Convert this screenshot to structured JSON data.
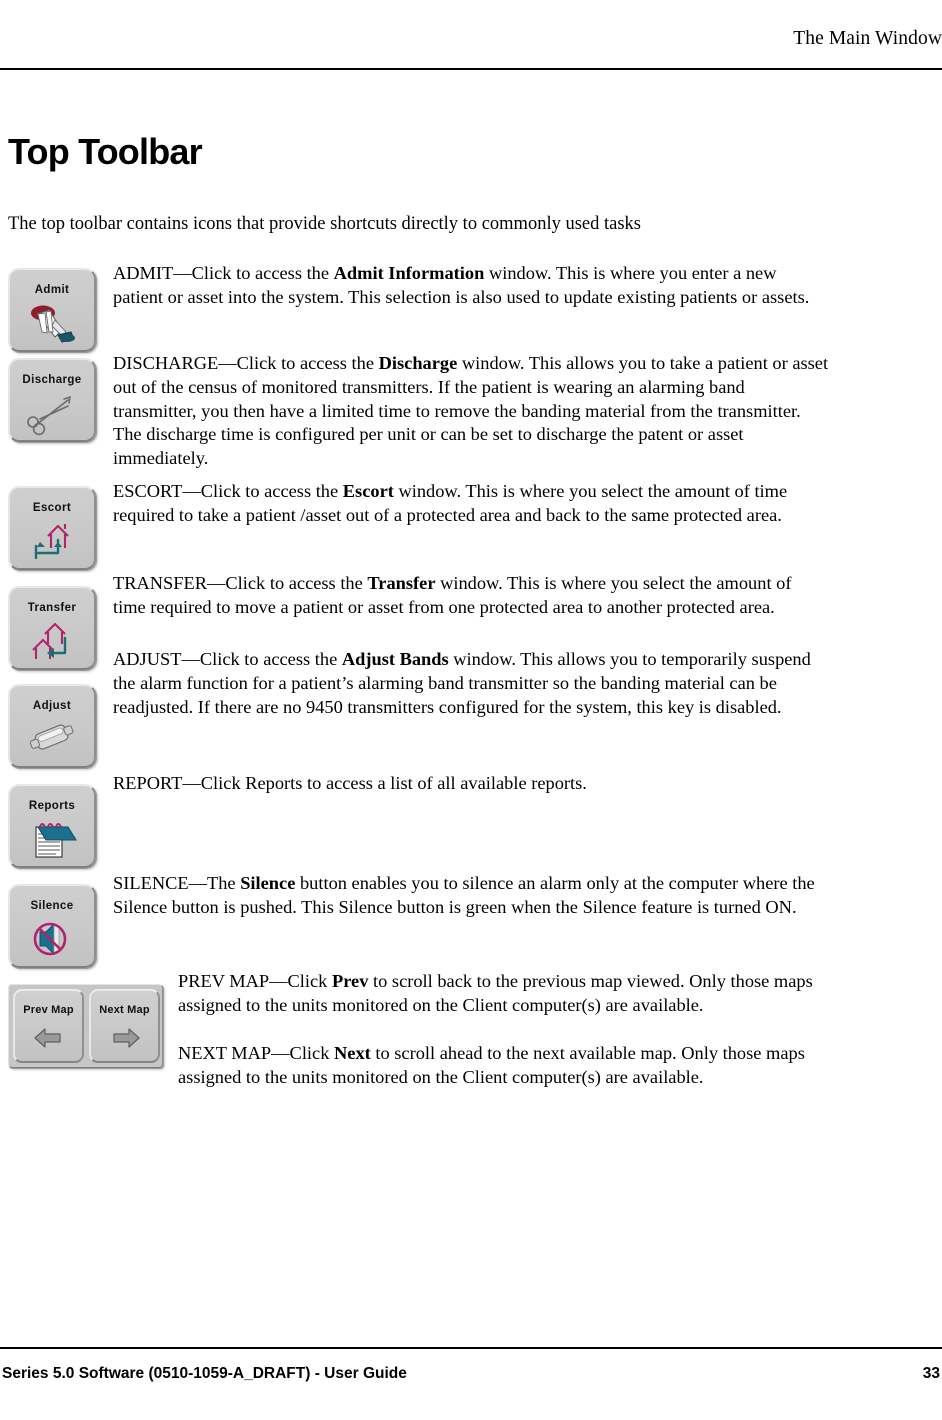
{
  "header": {
    "running_head": "The Main Window"
  },
  "heading": "Top Toolbar",
  "intro": "The top toolbar contains icons that provide shortcuts directly to commonly used tasks",
  "buttons": {
    "admit": {
      "label": "Admit",
      "icon": "hand-pointing-icon"
    },
    "discharge": {
      "label": "Discharge",
      "icon": "scissors-icon"
    },
    "escort": {
      "label": "Escort",
      "icon": "house-round-trip-arrow-icon"
    },
    "transfer": {
      "label": "Transfer",
      "icon": "two-houses-arrow-icon"
    },
    "adjust": {
      "label": "Adjust",
      "icon": "band-transmitter-icon"
    },
    "reports": {
      "label": "Reports",
      "icon": "notepad-icon"
    },
    "silence": {
      "label": "Silence",
      "icon": "speaker-muted-icon"
    },
    "prev_map": {
      "label": "Prev Map",
      "icon": "arrow-left-icon"
    },
    "next_map": {
      "label": "Next Map",
      "icon": "arrow-right-icon"
    }
  },
  "entries": [
    {
      "key": "admit",
      "lead": "ADMIT",
      "text_1": "ADMIT—Click to access the ",
      "bold_1": "Admit Information",
      "text_2": " window. This is where you enter a new patient or asset into the system. This selection is also used to update existing patients or assets."
    },
    {
      "key": "discharge",
      "lead": "DISCHARGE",
      "text_1": " DISCHARGE—Click to access the ",
      "bold_1": "Discharge",
      "text_2": " window. This allows you to take a patient or asset out of the census of monitored transmitters. If the patient is wearing an alarming band transmitter, you then have a limited time to remove the banding material from the transmitter. The discharge time is configured per unit or can be set to discharge the patent or asset immediately."
    },
    {
      "key": "escort",
      "lead": "ESCORT",
      "text_1": "ESCORT—Click to access the ",
      "bold_1": "Escort",
      "text_2": " window. This is where you select the amount of time required to take a patient /asset out of a protected area and back to the same protected area."
    },
    {
      "key": "transfer",
      "lead": "TRANSFER",
      "text_1": "TRANSFER—Click to access the ",
      "bold_1": "Transfer",
      "text_2": " window. This is where you select the amount of time required to move a patient or asset from one protected area to another protected area."
    },
    {
      "key": "adjust",
      "lead": "ADJUST",
      "text_1": "ADJUST—Click to access the ",
      "bold_1": "Adjust Bands",
      "text_2": " window. This allows you to temporarily suspend the alarm function for a patient’s alarming band transmitter so the banding material can be readjusted. If there are no 9450 transmitters configured for the system, this key is disabled."
    },
    {
      "key": "report",
      "lead": "REPORT",
      "text_1": "REPORT—Click Reports to access a list of all available reports.",
      "bold_1": "",
      "text_2": ""
    },
    {
      "key": "silence",
      "lead": "SILENCE",
      "text_1": "SILENCE—The ",
      "bold_1": "Silence",
      "text_2": " button enables you to silence an alarm only at the computer where the Silence button is pushed. This Silence button is green when the Silence feature is turned ON."
    },
    {
      "key": "prev_map",
      "lead": "PREV MAP",
      "text_1": "PREV MAP—Click ",
      "bold_1": "Prev",
      "text_2": " to scroll back to the previous map viewed. Only those maps assigned to the units monitored on the Client computer(s) are available."
    },
    {
      "key": "next_map",
      "lead": "NEXT MAP",
      "text_1": "NEXT MAP—Click ",
      "bold_1": "Next",
      "text_2": " to scroll ahead to the next available map. Only those maps assigned to the units monitored on the Client computer(s) are available."
    }
  ],
  "footer": {
    "left": "Series 5.0 Software (0510-1059-A_DRAFT) - User Guide",
    "page_number": "33"
  },
  "colors": {
    "house_outline": "#b0246b",
    "arrow_teal": "#1d6e74",
    "notepad_blue": "#1d6f8e",
    "admit_cuff": "#8f1d2e",
    "admit_base": "#1d5566",
    "button_face": "#c9c9c9"
  }
}
